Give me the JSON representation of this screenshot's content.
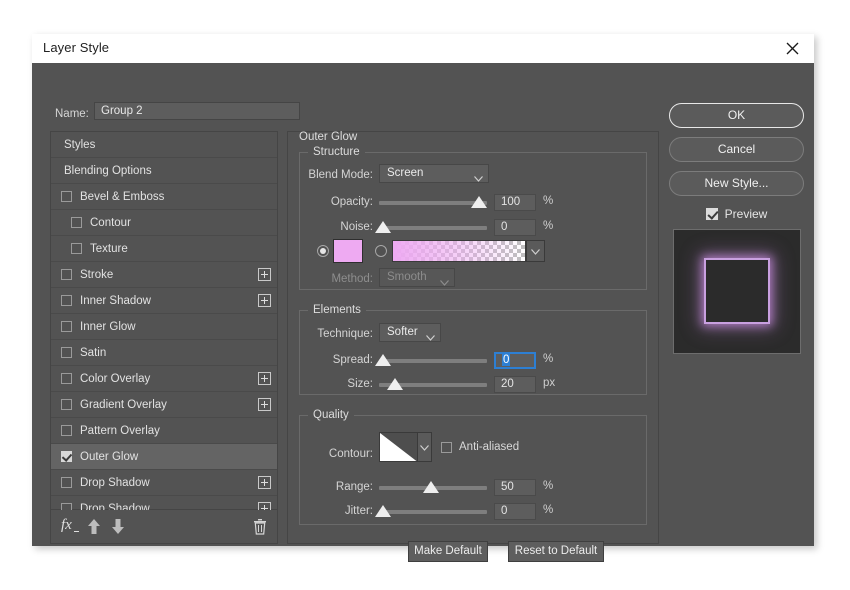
{
  "window": {
    "title": "Layer Style",
    "close_icon": "close-icon"
  },
  "name_row": {
    "label": "Name:",
    "value": "Group 2"
  },
  "styles_list": [
    {
      "label": "Styles",
      "type": "header",
      "checkbox": null,
      "plus": false,
      "active": false,
      "indent": 0
    },
    {
      "label": "Blending Options",
      "type": "header",
      "checkbox": null,
      "plus": false,
      "active": false,
      "indent": 0
    },
    {
      "label": "Bevel & Emboss",
      "type": "effect",
      "checkbox": false,
      "plus": false,
      "active": false,
      "indent": 1
    },
    {
      "label": "Contour",
      "type": "sub",
      "checkbox": false,
      "plus": false,
      "active": false,
      "indent": 2
    },
    {
      "label": "Texture",
      "type": "sub",
      "checkbox": false,
      "plus": false,
      "active": false,
      "indent": 2
    },
    {
      "label": "Stroke",
      "type": "effect",
      "checkbox": false,
      "plus": true,
      "active": false,
      "indent": 1
    },
    {
      "label": "Inner Shadow",
      "type": "effect",
      "checkbox": false,
      "plus": true,
      "active": false,
      "indent": 1
    },
    {
      "label": "Inner Glow",
      "type": "effect",
      "checkbox": false,
      "plus": false,
      "active": false,
      "indent": 1
    },
    {
      "label": "Satin",
      "type": "effect",
      "checkbox": false,
      "plus": false,
      "active": false,
      "indent": 1
    },
    {
      "label": "Color Overlay",
      "type": "effect",
      "checkbox": false,
      "plus": true,
      "active": false,
      "indent": 1
    },
    {
      "label": "Gradient Overlay",
      "type": "effect",
      "checkbox": false,
      "plus": true,
      "active": false,
      "indent": 1
    },
    {
      "label": "Pattern Overlay",
      "type": "effect",
      "checkbox": false,
      "plus": false,
      "active": false,
      "indent": 1
    },
    {
      "label": "Outer Glow",
      "type": "effect",
      "checkbox": true,
      "plus": false,
      "active": true,
      "indent": 1
    },
    {
      "label": "Drop Shadow",
      "type": "effect",
      "checkbox": false,
      "plus": true,
      "active": false,
      "indent": 1
    },
    {
      "label": "Drop Shadow",
      "type": "effect",
      "checkbox": false,
      "plus": true,
      "active": false,
      "indent": 1
    }
  ],
  "styles_toolbar": {
    "fx_icon": "fx-icon",
    "move_up_icon": "arrow-up-icon",
    "move_down_icon": "arrow-down-icon",
    "delete_icon": "trash-icon"
  },
  "panel": {
    "title": "Outer Glow",
    "structure": {
      "legend": "Structure",
      "blend_mode_label": "Blend Mode:",
      "blend_mode_value": "Screen",
      "opacity_label": "Opacity:",
      "opacity_value": "100",
      "opacity_unit": "%",
      "noise_label": "Noise:",
      "noise_value": "0",
      "noise_unit": "%",
      "fill_type": "color",
      "color_value": "#eeaaf2",
      "gradient_from": "#eeaaf2",
      "gradient_to": "transparent",
      "method_label": "Method:",
      "method_value": "Smooth"
    },
    "elements": {
      "legend": "Elements",
      "technique_label": "Technique:",
      "technique_value": "Softer",
      "spread_label": "Spread:",
      "spread_value": "0",
      "spread_unit": "%",
      "size_label": "Size:",
      "size_value": "20",
      "size_unit": "px"
    },
    "quality": {
      "legend": "Quality",
      "contour_label": "Contour:",
      "anti_aliased_label": "Anti-aliased",
      "anti_aliased_checked": false,
      "range_label": "Range:",
      "range_value": "50",
      "range_unit": "%",
      "jitter_label": "Jitter:",
      "jitter_value": "0",
      "jitter_unit": "%"
    },
    "footer": {
      "make_default": "Make Default",
      "reset_to_default": "Reset to Default"
    }
  },
  "actions": {
    "ok": "OK",
    "cancel": "Cancel",
    "new_style": "New Style...",
    "preview_label": "Preview",
    "preview_checked": true
  },
  "preview": {
    "glow_color": "#c9a0e0",
    "background": "#2b2b2b"
  },
  "sliders": {
    "opacity_pct": 100,
    "noise_pct": 0,
    "spread_pct": 0,
    "size_pct": 12,
    "range_pct": 50,
    "jitter_pct": 0
  }
}
